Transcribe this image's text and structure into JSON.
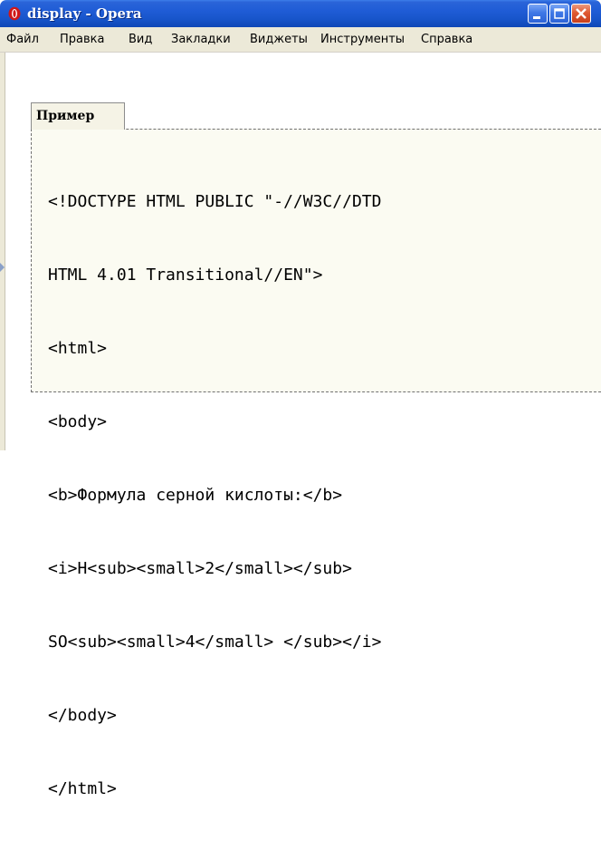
{
  "window": {
    "title": "display - Opera",
    "icon": "opera-icon",
    "controls": {
      "minimize": "minimize-icon",
      "maximize": "maximize-icon",
      "close": "close-icon"
    }
  },
  "menubar": {
    "items": [
      {
        "label": "Файл"
      },
      {
        "label": "Правка"
      },
      {
        "label": "Вид"
      },
      {
        "label": "Закладки"
      },
      {
        "label": "Виджеты"
      },
      {
        "label": "Инструменты"
      },
      {
        "label": "Справка"
      }
    ]
  },
  "example": {
    "tab_label": "Пример",
    "code_lines": [
      "<!DOCTYPE HTML PUBLIC \"-//W3C//DTD",
      "HTML 4.01 Transitional//EN\">",
      "<html>",
      "<body>",
      "<b>Формула серной кислоты:</b>",
      "<i>H<sub><small>2</small></sub>",
      "SO<sub><small>4</small> </sub></i>",
      "</body>",
      "</html>"
    ]
  },
  "colors": {
    "titlebar": "#1f5cd6",
    "menubar": "#ece9d8",
    "code_background": "#fbfbf2",
    "close_button": "#e05a33"
  }
}
